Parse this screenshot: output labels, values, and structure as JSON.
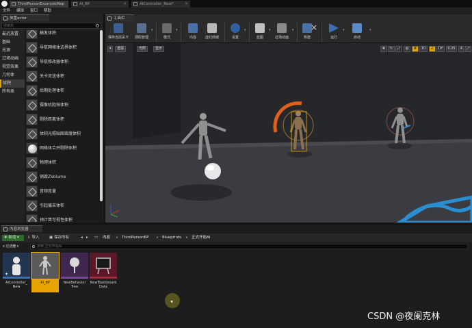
{
  "document_tabs": [
    {
      "label": "ThirdPersonExampleMap"
    },
    {
      "label": "AI_BP"
    },
    {
      "label": "AIController_New*"
    }
  ],
  "menu": [
    "文件",
    "编辑",
    "窗口",
    "帮助"
  ],
  "place_panel": {
    "tab_label": "放置actor",
    "search_placeholder": "搜索类",
    "categories": [
      {
        "label": "最近放置",
        "selected": false
      },
      {
        "label": "基础",
        "selected": false
      },
      {
        "label": "光源",
        "selected": false
      },
      {
        "label": "过场动画",
        "selected": false
      },
      {
        "label": "视觉效果",
        "selected": false
      },
      {
        "label": "几何体",
        "selected": false
      },
      {
        "label": "体积",
        "selected": true
      },
      {
        "label": "所有类",
        "selected": false
      }
    ],
    "actors": [
      {
        "label": "触发体积",
        "icon": "cube-icon"
      },
      {
        "label": "导航网格体边界体积",
        "icon": "cube-icon"
      },
      {
        "label": "导航修改器体积",
        "icon": "cube-icon"
      },
      {
        "label": "关卡流送体积",
        "icon": "cube-icon"
      },
      {
        "label": "后期处理体积",
        "icon": "cube-icon"
      },
      {
        "label": "摄像机阻挡体积",
        "icon": "cube-icon"
      },
      {
        "label": "剔除距离体积",
        "icon": "cube-icon"
      },
      {
        "label": "体积光照贴图密度体积",
        "icon": "cube-icon"
      },
      {
        "label": "网格体合并剔除体积",
        "icon": "sphere-icon"
      },
      {
        "label": "物理体积",
        "icon": "cube-icon"
      },
      {
        "label": "销毁ZVolume",
        "icon": "cube-icon"
      },
      {
        "label": "音频音量",
        "icon": "cube-icon"
      },
      {
        "label": "引起痛苦体积",
        "icon": "cube-icon"
      },
      {
        "label": "预计算可视性体积",
        "icon": "cube-icon"
      }
    ]
  },
  "toolbar": {
    "tab_label": "工具栏",
    "buttons": [
      {
        "label": "保存当前关卡",
        "icon": "save-icon",
        "color": "#4a7fc0"
      },
      {
        "label": "源码管理",
        "icon": "source-control-icon",
        "color": "#6f8fc0"
      },
      {
        "label": "模式",
        "icon": "modes-icon",
        "color": "#8a8a8a"
      },
      {
        "label": "内容",
        "icon": "content-icon",
        "color": "#5a8ac8"
      },
      {
        "label": "虚幻商城",
        "icon": "marketplace-icon",
        "color": "#c8c8c8"
      },
      {
        "label": "设置",
        "icon": "settings-icon",
        "color": "#3a6fb0"
      },
      {
        "label": "蓝图",
        "icon": "blueprints-icon",
        "color": "#d0d0d0"
      },
      {
        "label": "过场动画",
        "icon": "cinematics-icon",
        "color": "#a0a0a0"
      },
      {
        "label": "构建",
        "icon": "build-icon",
        "color": "#5a8ac8"
      },
      {
        "label": "运行",
        "icon": "play-icon",
        "color": "#4a7fc0"
      },
      {
        "label": "启动",
        "icon": "launch-icon",
        "color": "#6a9ad0"
      }
    ]
  },
  "viewport": {
    "chips": [
      "透视",
      "光照",
      "显示"
    ],
    "controls": [
      "10",
      "10°",
      "0.25",
      "4"
    ]
  },
  "content_browser": {
    "tab_label": "内容浏览器",
    "add_new_label": "新增",
    "import_label": "导入",
    "save_all_label": "保存所有",
    "breadcrumbs": [
      "内容",
      "ThirdPersonBP",
      "Blueprints",
      "正式开始AI"
    ],
    "filter_label": "过滤器",
    "search_placeholder": "搜索 正式开始AI",
    "assets": [
      {
        "label": "AIController_\nNew",
        "kind": "controller",
        "selected": false,
        "color": "#2c4a7a"
      },
      {
        "label": "AI_BP",
        "kind": "character",
        "selected": true,
        "color": "#6a6a6a"
      },
      {
        "label": "NewBehavior\nTree",
        "kind": "behavior-tree",
        "selected": false,
        "color": "#4a2a5a"
      },
      {
        "label": "NewBlackboard\nData",
        "kind": "blackboard",
        "selected": false,
        "color": "#6a1a2a"
      }
    ]
  },
  "watermark": "CSDN @夜阑克林"
}
